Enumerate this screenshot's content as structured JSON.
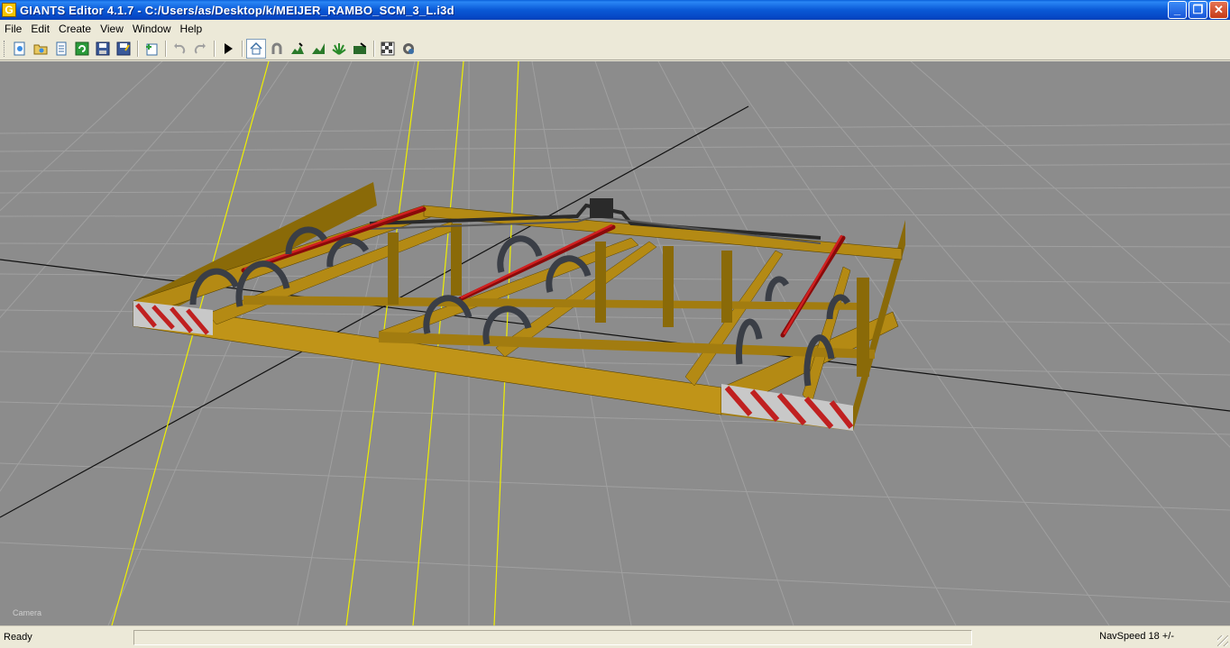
{
  "window": {
    "title": "GIANTS Editor 4.1.7 - C:/Users/as/Desktop/k/MEIJER_RAMBO_SCM_3_L.i3d",
    "app_icon_glyph": "G",
    "minimize": "_",
    "maximize": "❐",
    "close": "✕"
  },
  "menu": {
    "items": [
      "File",
      "Edit",
      "Create",
      "View",
      "Window",
      "Help"
    ]
  },
  "toolbar": {
    "icons": [
      "new-icon",
      "open-icon",
      "list-icon",
      "refresh-icon",
      "save-icon",
      "save-all-icon",
      "import-icon",
      "undo-icon",
      "redo-icon",
      "play-icon",
      "home-camera-icon",
      "magnet-icon",
      "terrain-paint-icon",
      "terrain-sculpt-icon",
      "foliage-paint-icon",
      "terrain-edit-icon",
      "xml-checker-icon",
      "settings-icon"
    ]
  },
  "viewport": {
    "background_color": "#8c8c8c",
    "camera_label": "Camera",
    "frame_color": "#b48a14"
  },
  "status": {
    "left": "Ready",
    "right": "NavSpeed 18 +/-"
  }
}
